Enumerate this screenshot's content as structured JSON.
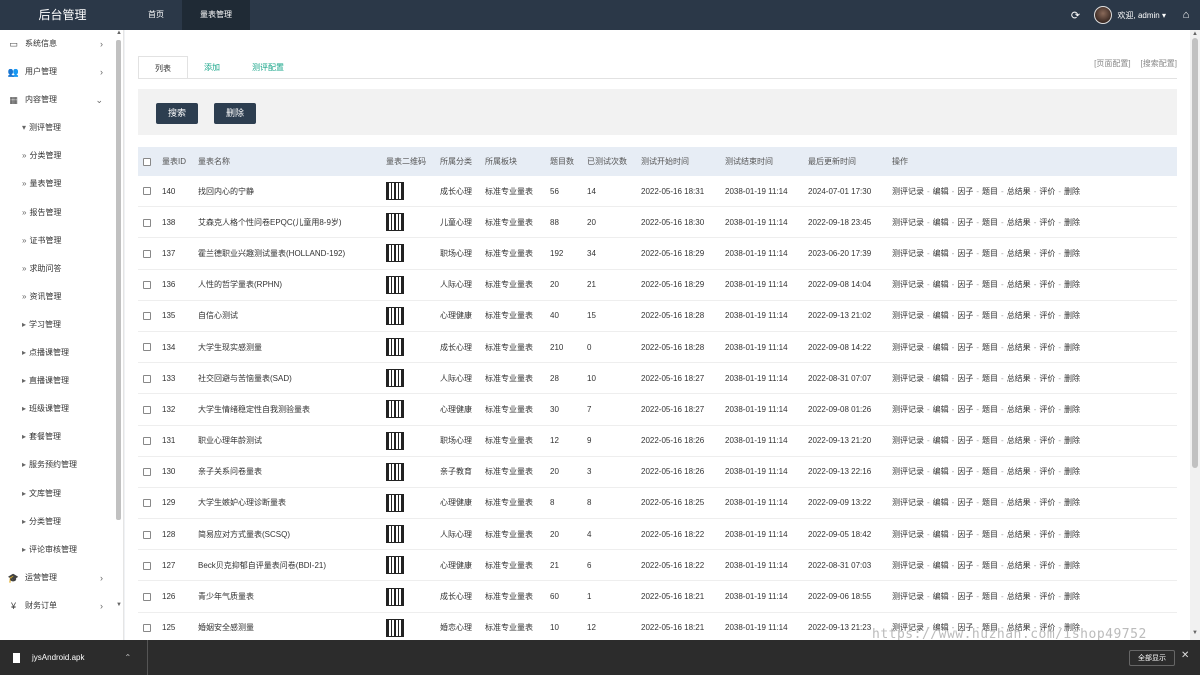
{
  "topbar": {
    "brand": "后台管理",
    "nav": [
      "首页",
      "量表管理"
    ],
    "welcome": "欢迎, admin ▾"
  },
  "sidebar": {
    "items": [
      {
        "label": "系统信息",
        "icon": "monitor-icon",
        "glyph": "▭",
        "arrow": "›",
        "level": 1
      },
      {
        "label": "用户管理",
        "icon": "users-icon",
        "glyph": "👥",
        "arrow": "›",
        "level": 1
      },
      {
        "label": "内容管理",
        "icon": "grid-icon",
        "glyph": "▦",
        "arrow": "⌄",
        "level": 1
      },
      {
        "label": "测评管理",
        "prefix": "▾",
        "level": 2
      },
      {
        "label": "分类管理",
        "prefix": "»",
        "level": 3
      },
      {
        "label": "量表管理",
        "prefix": "»",
        "level": 3
      },
      {
        "label": "报告管理",
        "prefix": "»",
        "level": 3
      },
      {
        "label": "证书管理",
        "prefix": "»",
        "level": 3
      },
      {
        "label": "求助问答",
        "prefix": "»",
        "level": 2
      },
      {
        "label": "资讯管理",
        "prefix": "»",
        "level": 2
      },
      {
        "label": "学习管理",
        "prefix": "▸",
        "level": 2
      },
      {
        "label": "点播课管理",
        "prefix": "▸",
        "level": 2
      },
      {
        "label": "直播课管理",
        "prefix": "▸",
        "level": 2
      },
      {
        "label": "班级课管理",
        "prefix": "▸",
        "level": 2
      },
      {
        "label": "套餐管理",
        "prefix": "▸",
        "level": 2
      },
      {
        "label": "服务预约管理",
        "prefix": "▸",
        "level": 2
      },
      {
        "label": "文库管理",
        "prefix": "▸",
        "level": 2
      },
      {
        "label": "分类管理",
        "prefix": "▸",
        "level": 2
      },
      {
        "label": "评论审核管理",
        "prefix": "▸",
        "level": 2
      },
      {
        "label": "运营管理",
        "icon": "graduation-cap-icon",
        "glyph": "🎓",
        "arrow": "›",
        "level": 1
      },
      {
        "label": "财务订单",
        "icon": "yen-icon",
        "glyph": "¥",
        "arrow": "›",
        "level": 1
      }
    ]
  },
  "tabs": [
    "列表",
    "添加",
    "测评配置"
  ],
  "right_links": [
    "[页面配置]",
    "[搜索配置]"
  ],
  "buttons": {
    "search": "搜索",
    "delete": "删除"
  },
  "table": {
    "headers": [
      "量表ID",
      "量表名称",
      "量表二维码",
      "所属分类",
      "所属板块",
      "题目数",
      "已测试次数",
      "测试开始时间",
      "测试结束时间",
      "最后更新时间",
      "操作"
    ],
    "ops": [
      "测评记录",
      "编辑",
      "因子",
      "题目",
      "总结果",
      "评价",
      "删除"
    ],
    "rows": [
      {
        "id": "140",
        "name": "找回内心的宁静",
        "cat": "成长心理",
        "block": "标准专业量表",
        "qnum": "56",
        "tested": "14",
        "start": "2022-05-16 18:31",
        "end": "2038-01-19 11:14",
        "updated": "2024-07-01 17:30"
      },
      {
        "id": "138",
        "name": "艾森克人格个性问卷EPQC(儿童用8-9岁)",
        "cat": "儿童心理",
        "block": "标准专业量表",
        "qnum": "88",
        "tested": "20",
        "start": "2022-05-16 18:30",
        "end": "2038-01-19 11:14",
        "updated": "2022-09-18 23:45"
      },
      {
        "id": "137",
        "name": "霍兰德职业兴趣测试量表(HOLLAND-192)",
        "cat": "职场心理",
        "block": "标准专业量表",
        "qnum": "192",
        "tested": "34",
        "start": "2022-05-16 18:29",
        "end": "2038-01-19 11:14",
        "updated": "2023-06-20 17:39"
      },
      {
        "id": "136",
        "name": "人性的哲学量表(RPHN)",
        "cat": "人际心理",
        "block": "标准专业量表",
        "qnum": "20",
        "tested": "21",
        "start": "2022-05-16 18:29",
        "end": "2038-01-19 11:14",
        "updated": "2022-09-08 14:04"
      },
      {
        "id": "135",
        "name": "自信心测试",
        "cat": "心理健康",
        "block": "标准专业量表",
        "qnum": "40",
        "tested": "15",
        "start": "2022-05-16 18:28",
        "end": "2038-01-19 11:14",
        "updated": "2022-09-13 21:02"
      },
      {
        "id": "134",
        "name": "大学生现实感测量",
        "cat": "成长心理",
        "block": "标准专业量表",
        "qnum": "210",
        "tested": "0",
        "start": "2022-05-16 18:28",
        "end": "2038-01-19 11:14",
        "updated": "2022-09-08 14:22"
      },
      {
        "id": "133",
        "name": "社交回避与苦恼量表(SAD)",
        "cat": "人际心理",
        "block": "标准专业量表",
        "qnum": "28",
        "tested": "10",
        "start": "2022-05-16 18:27",
        "end": "2038-01-19 11:14",
        "updated": "2022-08-31 07:07"
      },
      {
        "id": "132",
        "name": "大学生情绪稳定性自我测验量表",
        "cat": "心理健康",
        "block": "标准专业量表",
        "qnum": "30",
        "tested": "7",
        "start": "2022-05-16 18:27",
        "end": "2038-01-19 11:14",
        "updated": "2022-09-08 01:26"
      },
      {
        "id": "131",
        "name": "职业心理年龄测试",
        "cat": "职场心理",
        "block": "标准专业量表",
        "qnum": "12",
        "tested": "9",
        "start": "2022-05-16 18:26",
        "end": "2038-01-19 11:14",
        "updated": "2022-09-13 21:20"
      },
      {
        "id": "130",
        "name": "亲子关系问卷量表",
        "cat": "亲子教育",
        "block": "标准专业量表",
        "qnum": "20",
        "tested": "3",
        "start": "2022-05-16 18:26",
        "end": "2038-01-19 11:14",
        "updated": "2022-09-13 22:16"
      },
      {
        "id": "129",
        "name": "大学生嫉妒心理诊断量表",
        "cat": "心理健康",
        "block": "标准专业量表",
        "qnum": "8",
        "tested": "8",
        "start": "2022-05-16 18:25",
        "end": "2038-01-19 11:14",
        "updated": "2022-09-09 13:22"
      },
      {
        "id": "128",
        "name": "简易应对方式量表(SCSQ)",
        "cat": "人际心理",
        "block": "标准专业量表",
        "qnum": "20",
        "tested": "4",
        "start": "2022-05-16 18:22",
        "end": "2038-01-19 11:14",
        "updated": "2022-09-05 18:42"
      },
      {
        "id": "127",
        "name": "Beck贝克抑郁自评量表问卷(BDI-21)",
        "cat": "心理健康",
        "block": "标准专业量表",
        "qnum": "21",
        "tested": "6",
        "start": "2022-05-16 18:22",
        "end": "2038-01-19 11:14",
        "updated": "2022-08-31 07:03"
      },
      {
        "id": "126",
        "name": "青少年气质量表",
        "cat": "成长心理",
        "block": "标准专业量表",
        "qnum": "60",
        "tested": "1",
        "start": "2022-05-16 18:21",
        "end": "2038-01-19 11:14",
        "updated": "2022-09-06 18:55"
      },
      {
        "id": "125",
        "name": "婚姻安全感测量",
        "cat": "婚恋心理",
        "block": "标准专业量表",
        "qnum": "10",
        "tested": "12",
        "start": "2022-05-16 18:21",
        "end": "2038-01-19 11:14",
        "updated": "2022-09-13 21:23"
      }
    ]
  },
  "watermark": "https://www.huzhan.com/ishop49752",
  "download_bar": {
    "filename": "jysAndroid.apk",
    "show_all": "全部显示"
  }
}
